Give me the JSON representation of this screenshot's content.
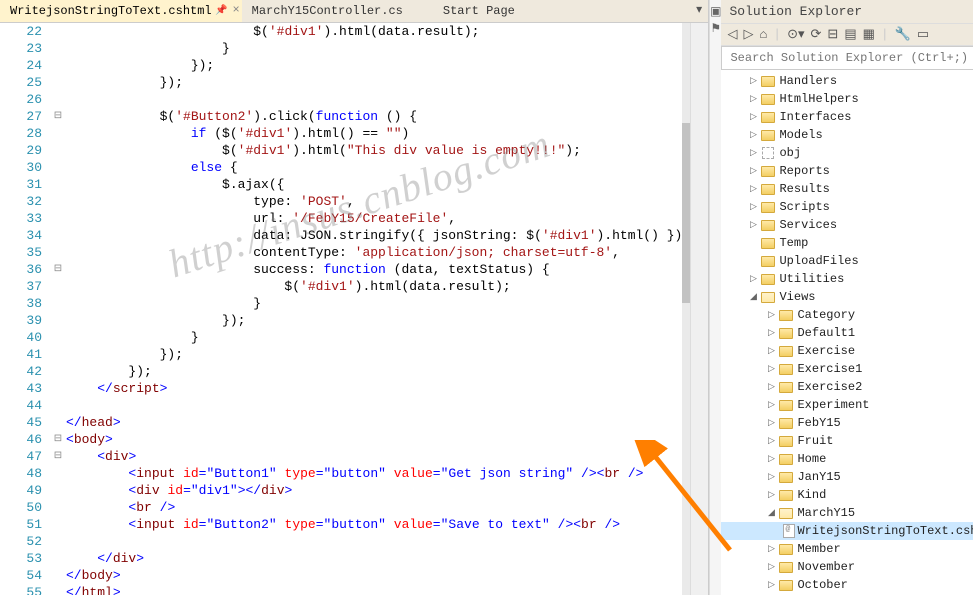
{
  "tabs": [
    {
      "label": "WritejsonStringToText.cshtml",
      "active": true,
      "pinned": true
    },
    {
      "label": "MarchY15Controller.cs",
      "active": false
    },
    {
      "label": "Start Page",
      "active": false
    }
  ],
  "lineStart": 22,
  "lineEnd": 55,
  "foldMarks": {
    "27": "−",
    "36": "−",
    "46": "−",
    "47": "−"
  },
  "code": [
    {
      "n": 22,
      "html": "                        $(<span class='str'>'#div1'</span>).html(data.result);"
    },
    {
      "n": 23,
      "html": "                    }"
    },
    {
      "n": 24,
      "html": "                });"
    },
    {
      "n": 25,
      "html": "            });"
    },
    {
      "n": 26,
      "html": ""
    },
    {
      "n": 27,
      "html": "            $(<span class='str'>'#Button2'</span>).click(<span class='kw'>function</span> () {"
    },
    {
      "n": 28,
      "html": "                <span class='kw'>if</span> ($(<span class='str'>'#div1'</span>).html() == <span class='str'>\"\"</span>)"
    },
    {
      "n": 29,
      "html": "                    $(<span class='str'>'#div1'</span>).html(<span class='str'>\"This div value is empty!!!\"</span>);"
    },
    {
      "n": 30,
      "html": "                <span class='kw'>else</span> {"
    },
    {
      "n": 31,
      "html": "                    $.ajax({"
    },
    {
      "n": 32,
      "html": "                        type: <span class='str'>'POST'</span>,"
    },
    {
      "n": 33,
      "html": "                        url: <span class='str'>'/FebY15/CreateFile'</span>,"
    },
    {
      "n": 34,
      "html": "                        data: JSON.stringify({ jsonString: $(<span class='str'>'#div1'</span>).html() }),"
    },
    {
      "n": 35,
      "html": "                        contentType: <span class='str'>'application/json; charset=utf-8'</span>,"
    },
    {
      "n": 36,
      "html": "                        success: <span class='kw'>function</span> (data, textStatus) {"
    },
    {
      "n": 37,
      "html": "                            $(<span class='str'>'#div1'</span>).html(data.result);"
    },
    {
      "n": 38,
      "html": "                        }"
    },
    {
      "n": 39,
      "html": "                    });"
    },
    {
      "n": 40,
      "html": "                }"
    },
    {
      "n": 41,
      "html": "            });"
    },
    {
      "n": 42,
      "html": "        });"
    },
    {
      "n": 43,
      "html": "    <span class='kw'>&lt;/</span><span class='tag'>script</span><span class='kw'>&gt;</span>"
    },
    {
      "n": 44,
      "html": ""
    },
    {
      "n": 45,
      "html": "<span class='kw'>&lt;/</span><span class='tag'>head</span><span class='kw'>&gt;</span>"
    },
    {
      "n": 46,
      "html": "<span class='kw'>&lt;</span><span class='tag'>body</span><span class='kw'>&gt;</span>"
    },
    {
      "n": 47,
      "html": "    <span class='kw'>&lt;</span><span class='tag'>div</span><span class='kw'>&gt;</span>"
    },
    {
      "n": 48,
      "html": "        <span class='kw'>&lt;</span><span class='tag'>input</span> <span class='attr'>id</span><span class='kw'>=</span><span class='kw'>\"Button1\"</span> <span class='attr'>type</span><span class='kw'>=</span><span class='kw'>\"button\"</span> <span class='attr'>value</span><span class='kw'>=</span><span class='kw'>\"Get json string\"</span> <span class='kw'>/&gt;&lt;</span><span class='tag'>br</span> <span class='kw'>/&gt;</span>"
    },
    {
      "n": 49,
      "html": "        <span class='kw'>&lt;</span><span class='tag'>div</span> <span class='attr'>id</span><span class='kw'>=</span><span class='kw'>\"div1\"</span><span class='kw'>&gt;&lt;/</span><span class='tag'>div</span><span class='kw'>&gt;</span>"
    },
    {
      "n": 50,
      "html": "        <span class='kw'>&lt;</span><span class='tag'>br</span> <span class='kw'>/&gt;</span>"
    },
    {
      "n": 51,
      "html": "        <span class='kw'>&lt;</span><span class='tag'>input</span> <span class='attr'>id</span><span class='kw'>=</span><span class='kw'>\"Button2\"</span> <span class='attr'>type</span><span class='kw'>=</span><span class='kw'>\"button\"</span> <span class='attr'>value</span><span class='kw'>=</span><span class='kw'>\"Save to text\"</span> <span class='kw'>/&gt;&lt;</span><span class='tag'>br</span> <span class='kw'>/&gt;</span>"
    },
    {
      "n": 52,
      "html": ""
    },
    {
      "n": 53,
      "html": "    <span class='kw'>&lt;/</span><span class='tag'>div</span><span class='kw'>&gt;</span>"
    },
    {
      "n": 54,
      "html": "<span class='kw'>&lt;/</span><span class='tag'>body</span><span class='kw'>&gt;</span>"
    },
    {
      "n": 55,
      "html": "<span class='kw'>&lt;/</span><span class='tag'>html</span><span class='kw'>&gt;</span>"
    }
  ],
  "explorer": {
    "title": "Solution Explorer",
    "searchPlaceholder": "Search Solution Explorer (Ctrl+;)",
    "toolbarIcons": [
      "back",
      "fwd",
      "home",
      "sep",
      "scope",
      "refresh",
      "collapse",
      "props",
      "showall",
      "sep",
      "wrench",
      "highlight"
    ],
    "tree": [
      {
        "indent": 1,
        "arrow": "▷",
        "type": "folder",
        "label": "Handlers"
      },
      {
        "indent": 1,
        "arrow": "▷",
        "type": "folder",
        "label": "HtmlHelpers"
      },
      {
        "indent": 1,
        "arrow": "▷",
        "type": "folder",
        "label": "Interfaces"
      },
      {
        "indent": 1,
        "arrow": "▷",
        "type": "folder",
        "label": "Models"
      },
      {
        "indent": 1,
        "arrow": "▷",
        "type": "obj",
        "label": "obj"
      },
      {
        "indent": 1,
        "arrow": "▷",
        "type": "folder",
        "label": "Reports"
      },
      {
        "indent": 1,
        "arrow": "▷",
        "type": "folder",
        "label": "Results"
      },
      {
        "indent": 1,
        "arrow": "▷",
        "type": "folder",
        "label": "Scripts"
      },
      {
        "indent": 1,
        "arrow": "▷",
        "type": "folder",
        "label": "Services"
      },
      {
        "indent": 1,
        "arrow": "",
        "type": "folder",
        "label": "Temp"
      },
      {
        "indent": 1,
        "arrow": "",
        "type": "folder",
        "label": "UploadFiles"
      },
      {
        "indent": 1,
        "arrow": "▷",
        "type": "folder",
        "label": "Utilities"
      },
      {
        "indent": 1,
        "arrow": "◢",
        "type": "folder-open",
        "label": "Views"
      },
      {
        "indent": 2,
        "arrow": "▷",
        "type": "folder",
        "label": "Category"
      },
      {
        "indent": 2,
        "arrow": "▷",
        "type": "folder",
        "label": "Default1"
      },
      {
        "indent": 2,
        "arrow": "▷",
        "type": "folder",
        "label": "Exercise"
      },
      {
        "indent": 2,
        "arrow": "▷",
        "type": "folder",
        "label": "Exercise1"
      },
      {
        "indent": 2,
        "arrow": "▷",
        "type": "folder",
        "label": "Exercise2"
      },
      {
        "indent": 2,
        "arrow": "▷",
        "type": "folder",
        "label": "Experiment"
      },
      {
        "indent": 2,
        "arrow": "▷",
        "type": "folder",
        "label": "FebY15"
      },
      {
        "indent": 2,
        "arrow": "▷",
        "type": "folder",
        "label": "Fruit"
      },
      {
        "indent": 2,
        "arrow": "▷",
        "type": "folder",
        "label": "Home"
      },
      {
        "indent": 2,
        "arrow": "▷",
        "type": "folder",
        "label": "JanY15"
      },
      {
        "indent": 2,
        "arrow": "▷",
        "type": "folder",
        "label": "Kind"
      },
      {
        "indent": 2,
        "arrow": "◢",
        "type": "folder-open",
        "label": "MarchY15"
      },
      {
        "indent": 3,
        "arrow": "",
        "type": "file",
        "label": "WritejsonStringToText.cshtml",
        "selected": true
      },
      {
        "indent": 2,
        "arrow": "▷",
        "type": "folder",
        "label": "Member"
      },
      {
        "indent": 2,
        "arrow": "▷",
        "type": "folder",
        "label": "November"
      },
      {
        "indent": 2,
        "arrow": "▷",
        "type": "folder",
        "label": "October"
      }
    ]
  },
  "watermark": "http://insus.cnblog.com"
}
